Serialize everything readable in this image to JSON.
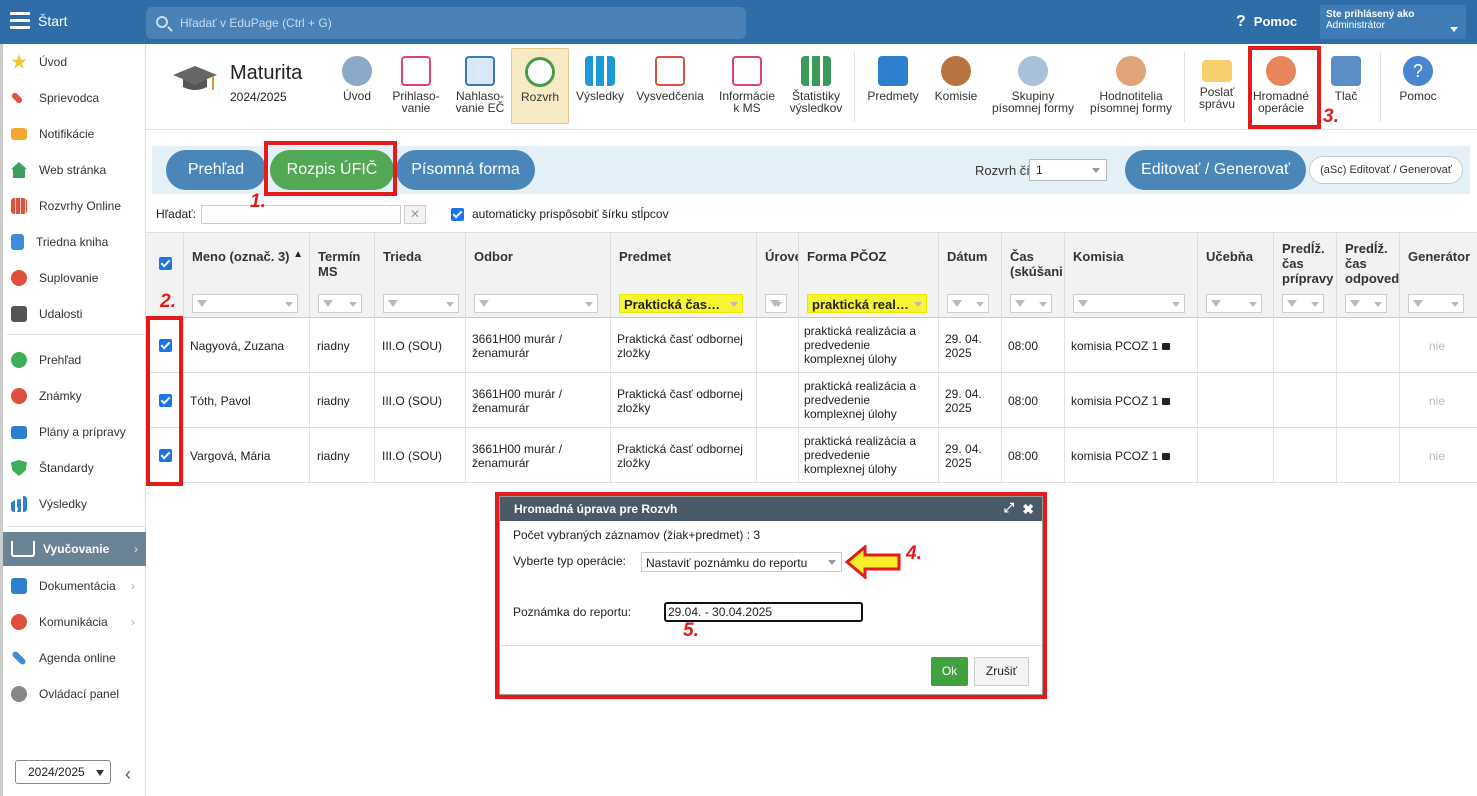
{
  "topbar": {
    "start": "Štart",
    "search_placeholder": "Hľadať v EduPage (Ctrl + G)",
    "help": "Pomoc",
    "user_line1": "Ste prihlásený ako",
    "user_line2": "Administrátor"
  },
  "sidebar": {
    "items": [
      "Úvod",
      "Sprievodca",
      "Notifikácie",
      "Web stránka",
      "Rozvrhy Online",
      "Triedna kniha",
      "Suplovanie",
      "Udalosti",
      "Prehľad",
      "Známky",
      "Plány a prípravy",
      "Štandardy",
      "Výsledky"
    ],
    "active": "Vyučovanie",
    "items2": [
      "Dokumentácia",
      "Komunikácia",
      "Agenda online",
      "Ovládací panel"
    ],
    "year": "2024/2025"
  },
  "module": {
    "title": "Maturita",
    "year": "2024/2025",
    "buttons": [
      {
        "l1": "Úvod",
        "l2": ""
      },
      {
        "l1": "Prihlaso-",
        "l2": "vanie"
      },
      {
        "l1": "Nahlaso-",
        "l2": "vanie EČ"
      },
      {
        "l1": "Rozvrh",
        "l2": ""
      },
      {
        "l1": "Výsledky",
        "l2": ""
      },
      {
        "l1": "Vysvedčenia",
        "l2": ""
      },
      {
        "l1": "Informácie",
        "l2": "k MS"
      },
      {
        "l1": "Štatistiky",
        "l2": "výsledkov"
      },
      {
        "l1": "Predmety",
        "l2": ""
      },
      {
        "l1": "Komisie",
        "l2": ""
      },
      {
        "l1": "Skupiny",
        "l2": "písomnej formy"
      },
      {
        "l1": "Hodnotitelia",
        "l2": "písomnej formy"
      },
      {
        "l1": "Poslať",
        "l2": "správu"
      },
      {
        "l1": "Hromadné",
        "l2": "operácie"
      },
      {
        "l1": "Tlač",
        "l2": ""
      },
      {
        "l1": "Pomoc",
        "l2": ""
      }
    ]
  },
  "tabs": {
    "prehlad": "Prehľad",
    "rozpis": "Rozpis ÚFIČ",
    "pisomna": "Písomná forma",
    "rozvrh_label": "Rozvrh číslo",
    "rozvrh_value": "1",
    "edit": "Editovať / Generovať",
    "asc": "(aSc) Editovať / Generovať"
  },
  "search": {
    "label": "Hľadať:",
    "clear": "✕",
    "auto": "automaticky prispôsobiť šírku stĺpcov"
  },
  "grid": {
    "headers": {
      "meno": "Meno (označ. 3)",
      "termin1": "Termín",
      "termin2": "MS",
      "trieda": "Trieda",
      "odbor": "Odbor",
      "predmet": "Predmet",
      "uroven": "Úrove",
      "forma": "Forma PČOZ",
      "datum": "Dátum",
      "cas1": "Čas",
      "cas2": "(skúšani",
      "komisia": "Komisia",
      "ucebna": "Učebňa",
      "prip1": "Predĺž.",
      "prip2": "čas",
      "prip3": "prípravy",
      "odp1": "Predĺž.",
      "odp2": "čas",
      "odp3": "odpoved",
      "generator": "Generátor",
      "sort": "▲"
    },
    "filters": {
      "predmet": "Praktická čas…",
      "forma": "praktická real…"
    },
    "rows": [
      {
        "meno": "Nagyová, Zuzana",
        "termin": "riadny",
        "trieda": "III.O (SOU)",
        "odbor1": "3661H00 murár /",
        "odbor2": "ženamurár",
        "predmet1": "Praktická časť odbornej",
        "predmet2": "zložky",
        "forma1": "praktická realizácia a",
        "forma2": "predvedenie",
        "forma3": "komplexnej úlohy",
        "datum1": "29. 04.",
        "datum2": "2025",
        "cas": "08:00",
        "komisia": "komisia PCOZ 1",
        "gen": "nie"
      },
      {
        "meno": "Tóth, Pavol",
        "termin": "riadny",
        "trieda": "III.O (SOU)",
        "odbor1": "3661H00 murár /",
        "odbor2": "ženamurár",
        "predmet1": "Praktická časť odbornej",
        "predmet2": "zložky",
        "forma1": "praktická realizácia a",
        "forma2": "predvedenie",
        "forma3": "komplexnej úlohy",
        "datum1": "29. 04.",
        "datum2": "2025",
        "cas": "08:00",
        "komisia": "komisia PCOZ 1",
        "gen": "nie"
      },
      {
        "meno": "Vargová, Mária",
        "termin": "riadny",
        "trieda": "III.O (SOU)",
        "odbor1": "3661H00 murár /",
        "odbor2": "ženamurár",
        "predmet1": "Praktická časť odbornej",
        "predmet2": "zložky",
        "forma1": "praktická realizácia a",
        "forma2": "predvedenie",
        "forma3": "komplexnej úlohy",
        "datum1": "29. 04.",
        "datum2": "2025",
        "cas": "08:00",
        "komisia": "komisia PCOZ 1",
        "gen": "nie"
      }
    ]
  },
  "dialog": {
    "title": "Hromadná úprava pre Rozvh",
    "count": "Počet vybraných záznamov (žiak+predmet) : 3",
    "op_label": "Vyberte typ operácie:",
    "op_value": "Nastaviť poznámku do reportu",
    "note_label": "Poznámka do reportu:",
    "note_value": "29.04. - 30.04.2025",
    "ok": "Ok",
    "cancel": "Zrušiť"
  },
  "annotations": {
    "n1": "1.",
    "n2": "2.",
    "n3": "3.",
    "n4": "4.",
    "n5": "5."
  },
  "colors": {
    "topbar": "#2f6da8",
    "pill_blue": "#4a86b8",
    "pill_green": "#53a855",
    "annotation_red": "#e41b1b",
    "highlight_yellow": "#f5f531"
  }
}
